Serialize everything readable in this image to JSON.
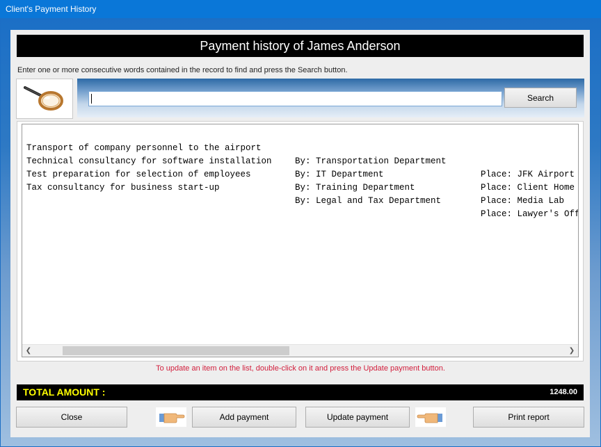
{
  "window": {
    "title": "Client's Payment History"
  },
  "header": {
    "title": "Payment history of James Anderson"
  },
  "search": {
    "hint": "Enter one or more consecutive words contained in the record to find and press the Search button.",
    "value": "",
    "button_label": "Search"
  },
  "records": [
    {
      "description": "Transport of company personnel to the airport",
      "by": "By: Transportation Department",
      "place": "Place: JFK Airport"
    },
    {
      "description": "Technical consultancy for software installation",
      "by": "By: IT Department",
      "place": "Place: Client Home"
    },
    {
      "description": "Test preparation for selection of employees",
      "by": "By: Training Department",
      "place": "Place: Media Lab"
    },
    {
      "description": "Tax consultancy for business start-up",
      "by": "By: Legal and Tax Department",
      "place": "Place: Lawyer's Off"
    }
  ],
  "list_hint": "To update an item on the list, double-click on it and press the Update payment button.",
  "total": {
    "label": "TOTAL AMOUNT :",
    "value": "1248.00"
  },
  "buttons": {
    "close": "Close",
    "add_payment": "Add payment",
    "update_payment": "Update payment",
    "print_report": "Print report"
  },
  "icons": {
    "search": "magnifying-glass-icon",
    "pointer": "pointing-hand-icon"
  },
  "colors": {
    "header_bg": "#000000",
    "total_label": "#ffff00",
    "hint_red": "#d21e3c",
    "titlebar": "#0a77d8"
  }
}
